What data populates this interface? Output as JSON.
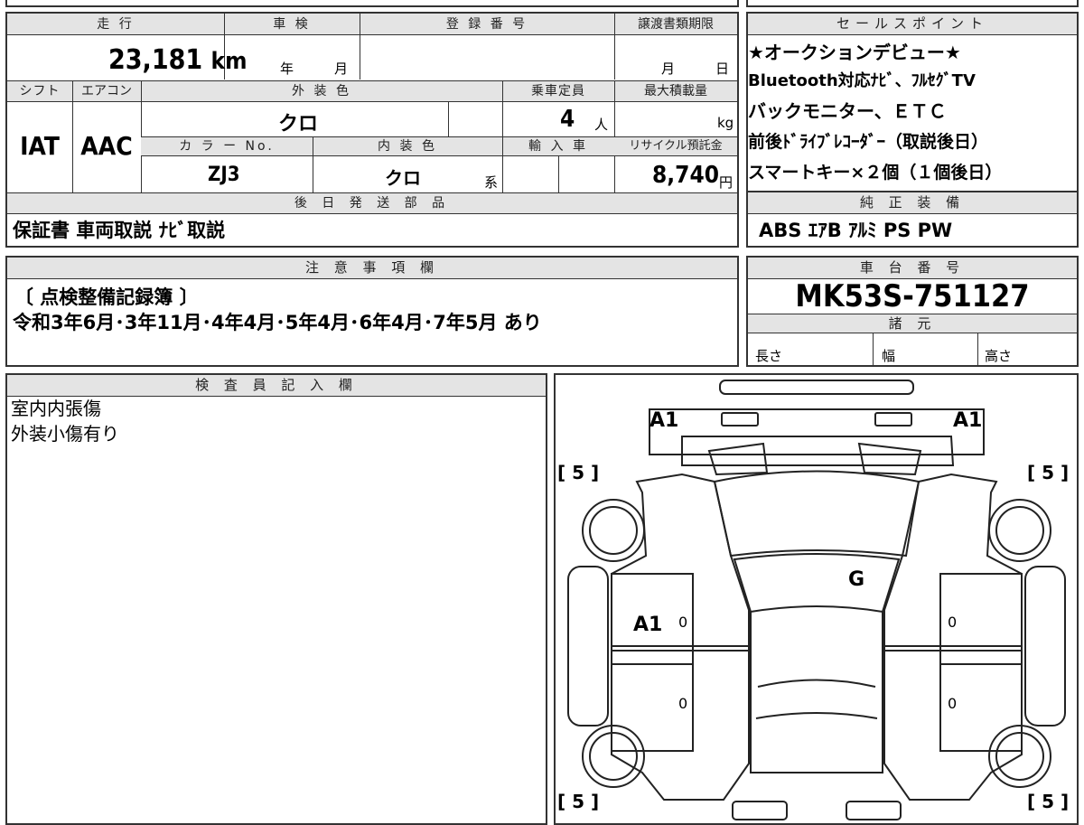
{
  "vehicle": {
    "mileage_label": "走 行",
    "mileage_value": "23,181",
    "mileage_unit": "km",
    "shaken_label": "車 検",
    "shaken_year_unit": "年",
    "shaken_month_unit": "月",
    "reg_number_label": "登 録 番 号",
    "transfer_deadline_label": "譲渡書類期限",
    "transfer_month_unit": "月",
    "transfer_day_unit": "日",
    "shift_label": "シフト",
    "shift_value": "IAT",
    "aircon_label": "エアコン",
    "aircon_value": "AAC",
    "exterior_color_label": "外 装 色",
    "exterior_color_value": "クロ",
    "capacity_label": "乗車定員",
    "capacity_value": "4",
    "capacity_unit": "人",
    "max_load_label": "最大積載量",
    "max_load_unit": "kg",
    "color_no_label": "カ ラ ー No.",
    "color_no_value": "ZJ3",
    "interior_color_label": "内 装 色",
    "interior_color_value": "クロ",
    "interior_color_suffix": "系",
    "import_label": "輸 入 車",
    "recycle_label": "リサイクル預託金",
    "recycle_value": "8,740",
    "recycle_unit": "円"
  },
  "sales_points": {
    "header": "セールスポイント",
    "lines": [
      "★オークションデビュー★",
      "Bluetooth対応ﾅﾋﾞ、ﾌﾙｾｸﾞTV",
      "バックモニター、ＥＴＣ",
      "前後ﾄﾞﾗｲﾌﾞﾚｺｰﾀﾞｰ（取説後日）",
      "スマートキー×２個（１個後日）"
    ]
  },
  "later_parts": {
    "header": "後 日 発 送 部 品",
    "value": "保証書 車両取説 ﾅﾋﾞ取説"
  },
  "standard_equipment": {
    "header": "純 正 装 備",
    "value": "ABS ｴｱB ｱﾙﾐ PS PW"
  },
  "notes": {
    "header": "注 意 事 項 欄",
    "line1": "〔 点検整備記録簿 〕",
    "line2": "令和3年6月･3年11月･4年4月･5年4月･6年4月･7年5月 あり"
  },
  "chassis": {
    "header": "車 台 番 号",
    "value": "MK53S-751127",
    "specs_header": "諸 元",
    "length_label": "長さ",
    "width_label": "幅",
    "height_label": "高さ"
  },
  "inspector": {
    "header": "検 査 員 記 入 欄",
    "line1": "室内内張傷",
    "line2": "外装小傷有り"
  },
  "diagram": {
    "mark_a1_front_left": "A1",
    "mark_a1_front_right": "A1",
    "mark_a1_side": "A1",
    "mark_g": "G",
    "tire_fl": "[ 5 ]",
    "tire_fr": "[ 5 ]",
    "tire_rl": "[ 5 ]",
    "tire_rr": "[ 5 ]",
    "door_marks": [
      "0",
      "0",
      "0",
      "0"
    ]
  }
}
